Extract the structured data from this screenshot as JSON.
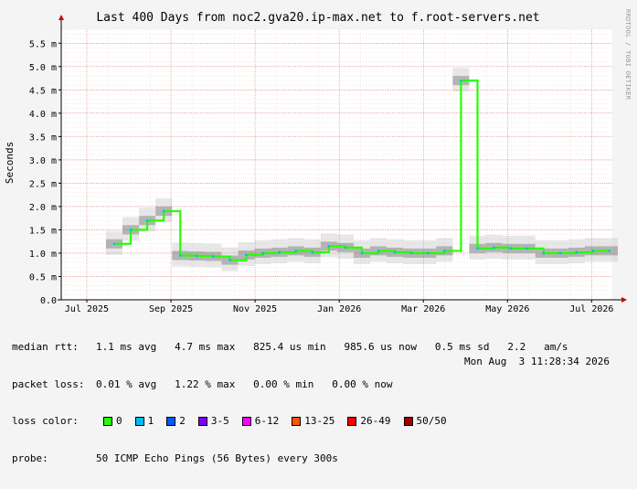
{
  "chart_data": {
    "type": "area",
    "title": "Last 400 Days from noc2.gva20.ip-max.net to f.root-servers.net",
    "ylabel": "Seconds",
    "xlabel": "",
    "ylim": [
      0,
      5.8
    ],
    "yticks": [
      {
        "value": 0.0,
        "label": "0.0"
      },
      {
        "value": 0.5,
        "label": "0.5 m"
      },
      {
        "value": 1.0,
        "label": "1.0 m"
      },
      {
        "value": 1.5,
        "label": "1.5 m"
      },
      {
        "value": 2.0,
        "label": "2.0 m"
      },
      {
        "value": 2.5,
        "label": "2.5 m"
      },
      {
        "value": 3.0,
        "label": "3.0 m"
      },
      {
        "value": 3.5,
        "label": "3.5 m"
      },
      {
        "value": 4.0,
        "label": "4.0 m"
      },
      {
        "value": 4.5,
        "label": "4.5 m"
      },
      {
        "value": 5.0,
        "label": "5.0 m"
      },
      {
        "value": 5.5,
        "label": "5.5 m"
      }
    ],
    "xticks": [
      "Jul 2025",
      "Sep 2025",
      "Nov 2025",
      "Jan 2026",
      "Mar 2026",
      "May 2026",
      "Jul 2026"
    ],
    "grid": true,
    "series": [
      {
        "name": "median rtt",
        "x": [
          "Jul 2025",
          "",
          "",
          "",
          "",
          "Sep 2025",
          "",
          "",
          "",
          "",
          "Nov 2025",
          "",
          "",
          "",
          "",
          "Jan 2026",
          "",
          "",
          "",
          "",
          "Mar 2026",
          "",
          "",
          "",
          "",
          "May 2026",
          "",
          "",
          "",
          "",
          "Jul 2026"
        ],
        "values": [
          1.2,
          1.5,
          1.7,
          1.9,
          0.95,
          0.94,
          0.93,
          0.85,
          0.96,
          1.0,
          1.02,
          1.05,
          1.02,
          1.15,
          1.12,
          1.0,
          1.05,
          1.02,
          1.0,
          1.0,
          1.05,
          4.7,
          1.1,
          1.12,
          1.1,
          1.1,
          1.0,
          1.0,
          1.02,
          1.05,
          1.05
        ]
      }
    ]
  },
  "stats": {
    "median_rtt_label": "median rtt:",
    "median_rtt_values": "1.1 ms avg   4.7 ms max   825.4 us min   985.6 us now   0.5 ms sd   2.2   am/s",
    "packet_loss_label": "packet loss:",
    "packet_loss_values": "0.01 % avg   1.22 % max   0.00 % min   0.00 % now",
    "loss_color_label": "loss color:",
    "probe_label": "probe:",
    "probe_values": "50 ICMP Echo Pings (56 Bytes) every 300s",
    "timestamp": "Mon Aug  3 11:28:34 2026"
  },
  "loss_colors": [
    {
      "label": "0",
      "color": "#26ff00"
    },
    {
      "label": "1",
      "color": "#00b8ff"
    },
    {
      "label": "2",
      "color": "#0059ff"
    },
    {
      "label": "3-5",
      "color": "#7e00ff"
    },
    {
      "label": "6-12",
      "color": "#ff00ff"
    },
    {
      "label": "13-25",
      "color": "#ff5500"
    },
    {
      "label": "26-49",
      "color": "#ff0000"
    },
    {
      "label": "50/50",
      "color": "#a10000"
    }
  ],
  "side_note": "RRDTOOL / TOBI OETIKER"
}
